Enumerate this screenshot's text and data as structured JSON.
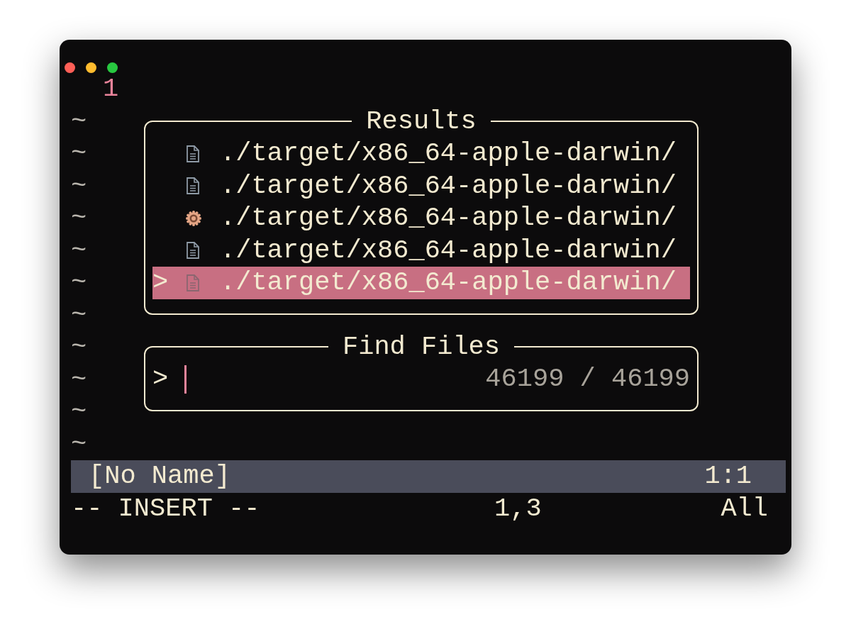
{
  "editor": {
    "line_numbers": [
      "1"
    ],
    "empty_line_markers": [
      "~",
      "~",
      "~",
      "~",
      "~",
      "~",
      "~",
      "~",
      "~",
      "~",
      "~"
    ]
  },
  "results": {
    "title": "Results",
    "selection_marker": ">",
    "items": [
      {
        "kind": "file",
        "path": "./target/x86_64-apple-darwin/",
        "selected": false
      },
      {
        "kind": "file",
        "path": "./target/x86_64-apple-darwin/",
        "selected": false
      },
      {
        "kind": "rust",
        "path": "./target/x86_64-apple-darwin/",
        "selected": false
      },
      {
        "kind": "file",
        "path": "./target/x86_64-apple-darwin/",
        "selected": false
      },
      {
        "kind": "file",
        "path": "./target/x86_64-apple-darwin/",
        "selected": true
      }
    ]
  },
  "finder": {
    "title": "Find Files",
    "prompt": ">",
    "count": "46199 / 46199"
  },
  "status_line": {
    "file": "[No Name]",
    "position": "1:1"
  },
  "command_line": {
    "mode": "-- INSERT --",
    "cursor": "1,3",
    "scroll": "All"
  }
}
